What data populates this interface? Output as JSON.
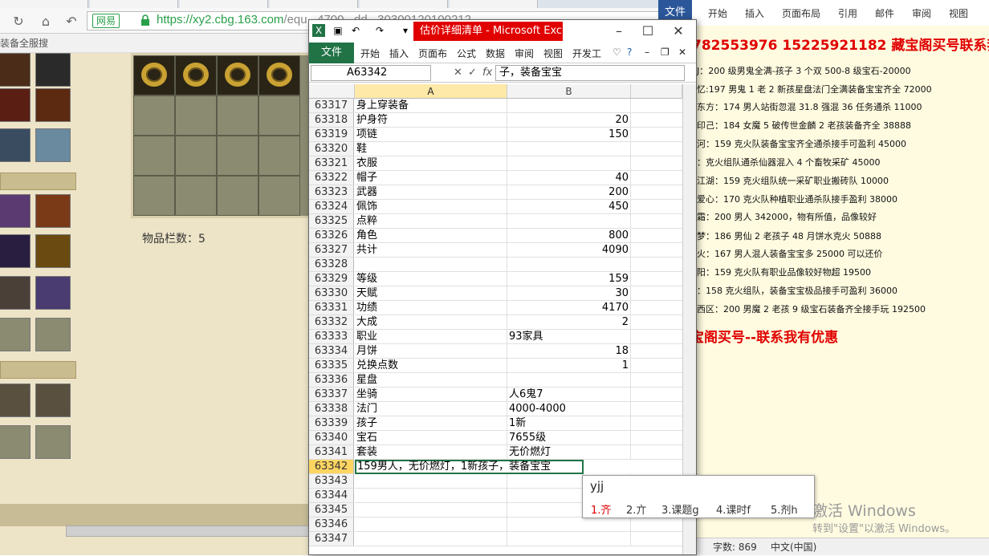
{
  "browser": {
    "url_domain": "https://xy2.cbg.163.com",
    "url_rest": "/equ...4700...dd...30300120100212",
    "cert_label": "网易",
    "bookmark_text": "装备全服搜",
    "item_count_label": "物品栏数：5"
  },
  "excel": {
    "title": "估价详细清单 - Microsoft Exc...",
    "file_tab": "文件",
    "ribbon_tabs": [
      "开始",
      "插入",
      "页面布",
      "公式",
      "数据",
      "审阅",
      "视图",
      "开发工"
    ],
    "namebox": "A63342",
    "formula": "子，装备宝宝",
    "columns": [
      "A",
      "B"
    ],
    "rows": [
      {
        "n": "63317",
        "a": "身上穿装备",
        "b": "",
        "num": false
      },
      {
        "n": "63318",
        "a": "护身符",
        "b": "20",
        "num": true
      },
      {
        "n": "63319",
        "a": "项链",
        "b": "150",
        "num": true
      },
      {
        "n": "63320",
        "a": "鞋",
        "b": "",
        "num": false
      },
      {
        "n": "63321",
        "a": "衣服",
        "b": "",
        "num": false
      },
      {
        "n": "63322",
        "a": "帽子",
        "b": "40",
        "num": true
      },
      {
        "n": "63323",
        "a": "武器",
        "b": "200",
        "num": true
      },
      {
        "n": "63324",
        "a": "佩饰",
        "b": "450",
        "num": true
      },
      {
        "n": "63325",
        "a": "点粹",
        "b": "",
        "num": false
      },
      {
        "n": "63326",
        "a": "角色",
        "b": "800",
        "num": true
      },
      {
        "n": "63327",
        "a": "共计",
        "b": "4090",
        "num": true
      },
      {
        "n": "63328",
        "a": "",
        "b": "",
        "num": false
      },
      {
        "n": "63329",
        "a": "等级",
        "b": "159",
        "num": true
      },
      {
        "n": "63330",
        "a": "天赋",
        "b": "30",
        "num": true
      },
      {
        "n": "63331",
        "a": "功绩",
        "b": "4170",
        "num": true
      },
      {
        "n": "63332",
        "a": "大成",
        "b": "2",
        "num": true
      },
      {
        "n": "63333",
        "a": "职业",
        "b": "93家具",
        "num": false
      },
      {
        "n": "63334",
        "a": "月饼",
        "b": "18",
        "num": true
      },
      {
        "n": "63335",
        "a": "兑换点数",
        "b": "1",
        "num": true
      },
      {
        "n": "63336",
        "a": "星盘",
        "b": "",
        "num": false
      },
      {
        "n": "63337",
        "a": "坐骑",
        "b": "人6鬼7",
        "num": false
      },
      {
        "n": "63338",
        "a": "法门",
        "b": "4000-4000",
        "num": false
      },
      {
        "n": "63339",
        "a": "孩子",
        "b": "1新",
        "num": false
      },
      {
        "n": "63340",
        "a": "宝石",
        "b": "7655级",
        "num": false
      },
      {
        "n": "63341",
        "a": "套装",
        "b": "无价燃灯",
        "num": false
      }
    ],
    "active_row": "63342",
    "active_text": "159男人，无价燃灯，1新孩子，装备宝宝",
    "empty_rows": [
      "63343",
      "63344",
      "63345",
      "63346",
      "63347"
    ]
  },
  "ime": {
    "input": "yjj",
    "candidates": [
      "1.齐",
      "2.亣",
      "3.课题g",
      "4.课时f",
      "5.剂h"
    ]
  },
  "word": {
    "file_tab": "文件",
    "tabs": [
      "开始",
      "插入",
      "页面布局",
      "引用",
      "邮件",
      "审阅",
      "视图"
    ],
    "phone_line": "782553976   15225921182 藏宝阁买号联系我,",
    "lines": [
      "J：200 级男鬼全满-孩子 3 个双 500-8 级宝石-20000",
      "忆:197 男鬼 1 老 2 新孩星盘法门全满装备宝宝齐全 72000",
      "东方：174 男人站街忽混 31.8 强混 36 任务通杀 11000",
      "印己：184 女魔 5 破传世金麟 2 老孩装备齐全 38888",
      "河：159 克火队装备宝宝齐全通杀接手可盈利 45000",
      "：克火组队通杀仙器混入 4 个畜牧采矿 45000",
      "江湖：159 克火组队统一采矿职业搬砖队 10000",
      "爱心：170 克火队种植职业通杀队接手盈利 38000",
      "霜：200 男人 342000，物有所值，品像较好",
      "梦：186 男仙 2 老孩子 48 月饼水克火 50888",
      "火：167 男人混人装备宝宝多 25000 可以还价",
      "阳：159 克火队有职业品像较好物超 19500",
      "：158 克火组队，装备宝宝极品接手可盈利 36000",
      "西区：200 男魔 2 老孩 9 级宝石装备齐全接手玩 192500"
    ],
    "promo": "宝阁买号--联系我有优惠",
    "status_words": "字数: 869",
    "status_lang": "中文(中国)",
    "watermark1": "激活 Windows",
    "watermark2": "转到\"设置\"以激活 Windows。"
  }
}
